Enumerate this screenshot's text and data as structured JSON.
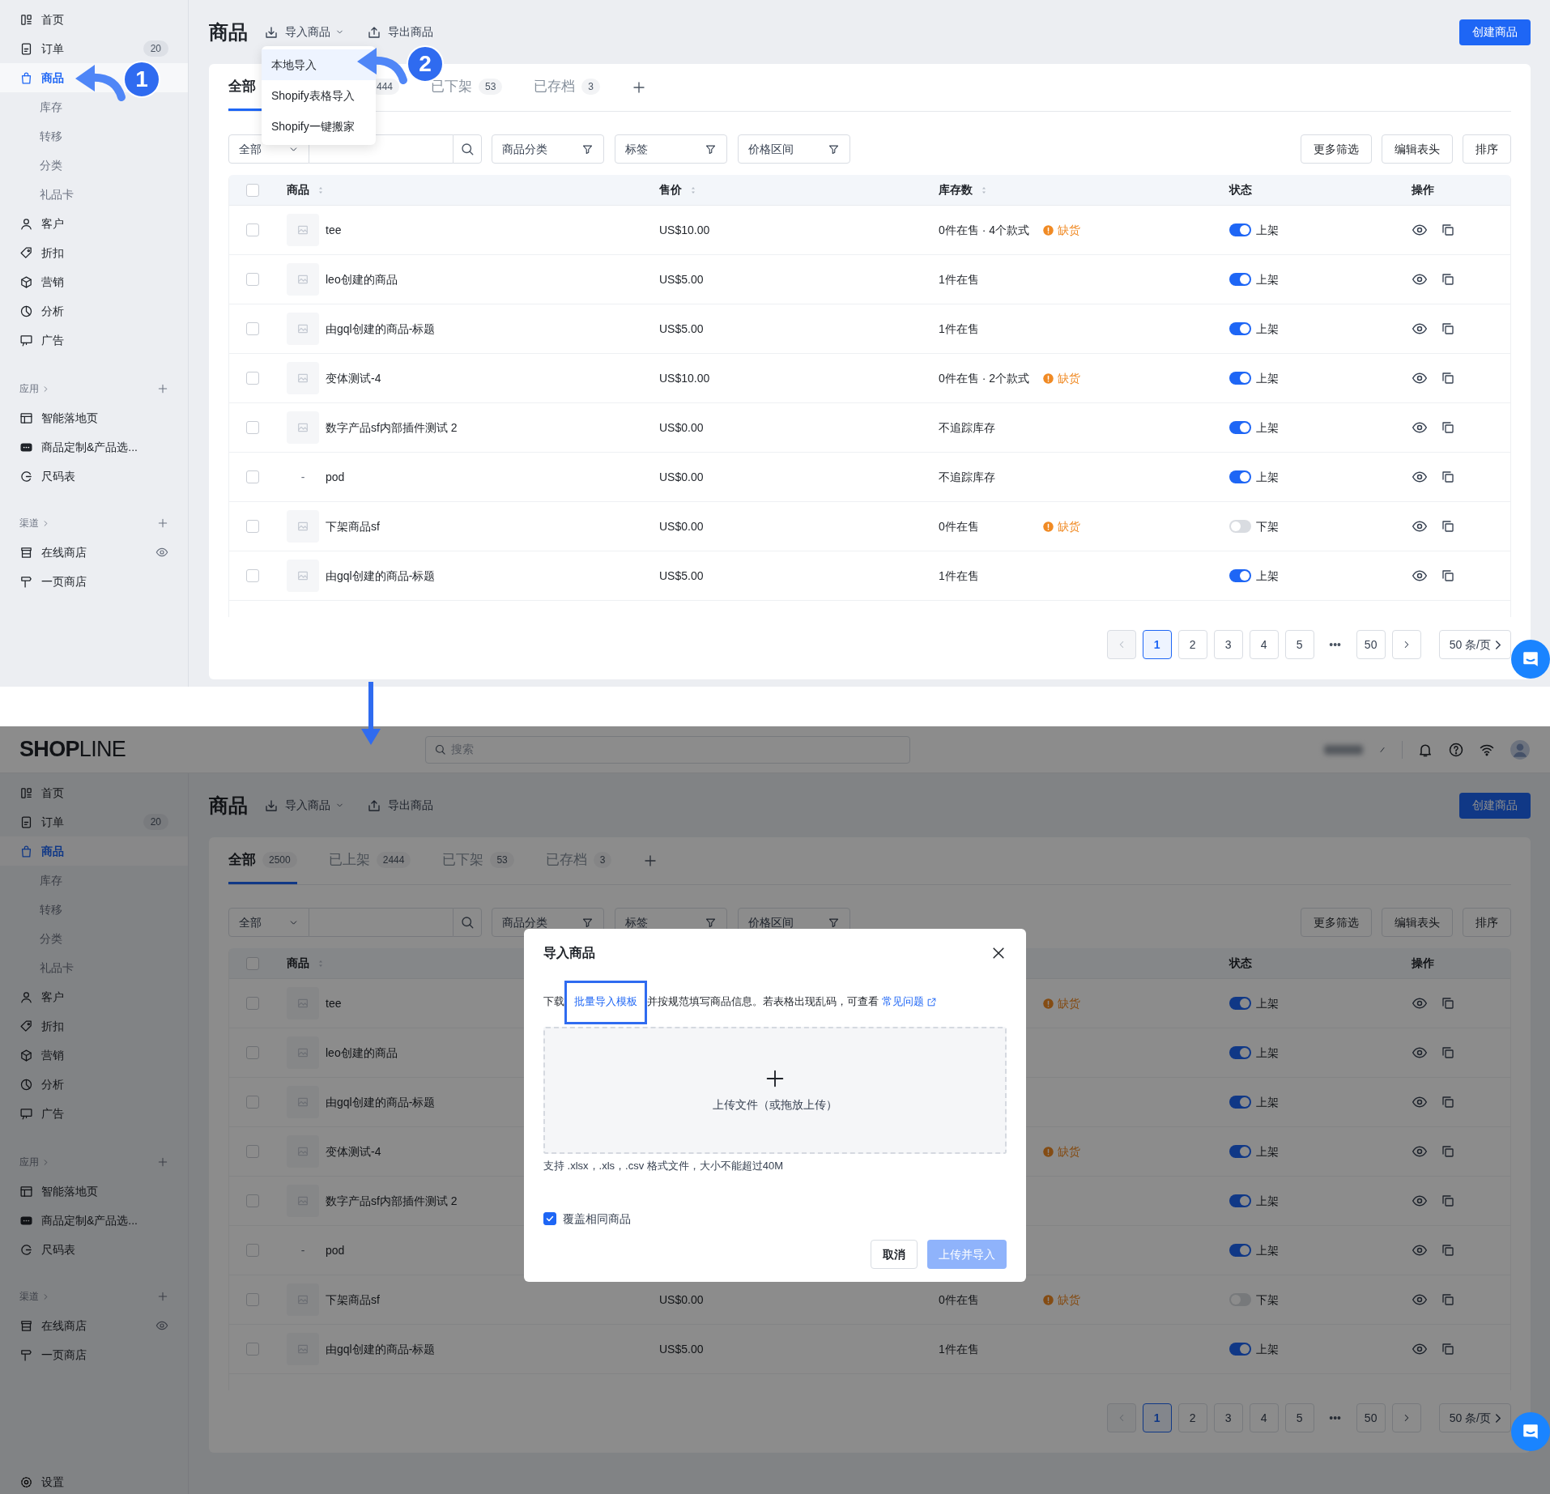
{
  "top_screen": {
    "sidebar": {
      "items": [
        {
          "label": "首页",
          "selected": false
        },
        {
          "label": "订单",
          "badge": "20",
          "selected": false
        },
        {
          "label": "商品",
          "selected": true,
          "children": [
            {
              "label": "库存",
              "selected": false
            },
            {
              "label": "转移",
              "selected": false
            },
            {
              "label": "分类",
              "selected": false
            },
            {
              "label": "礼品卡",
              "selected": false
            }
          ]
        },
        {
          "label": "客户",
          "selected": false
        },
        {
          "label": "折扣",
          "selected": false
        },
        {
          "label": "营销",
          "selected": false
        },
        {
          "label": "分析",
          "selected": false
        },
        {
          "label": "广告",
          "selected": false
        }
      ],
      "sections": [
        {
          "title": "应用",
          "items": [
            {
              "label": "智能落地页",
              "selected": false
            },
            {
              "label": "商品定制&产品选...",
              "selected": false
            },
            {
              "label": "尺码表",
              "selected": false
            }
          ]
        },
        {
          "title": "渠道",
          "items": [
            {
              "label": "在线商店",
              "selected": false,
              "kind": "previewable"
            },
            {
              "label": "一页商店",
              "selected": false
            }
          ]
        }
      ]
    },
    "page": {
      "title": "商品",
      "actions": [
        {
          "label": "导入商品",
          "kind": "dropdown"
        },
        {
          "label": "导出商品",
          "kind": "export"
        }
      ],
      "create_button": "创建商品"
    },
    "import_menu": {
      "items": [
        {
          "label": "本地导入",
          "selected": true
        },
        {
          "label": "Shopify表格导入",
          "selected": false
        },
        {
          "label": "Shopify一键搬家",
          "selected": false
        }
      ]
    },
    "steps": [
      "1",
      "2"
    ],
    "tabs": [
      {
        "label": "全部",
        "selected": true
      },
      {
        "count": "444",
        "selected": false
      },
      {
        "label": "已下架",
        "count": "53",
        "selected": false
      },
      {
        "label": "已存档",
        "count": "3",
        "selected": false
      }
    ],
    "filters": {
      "select": "全部",
      "dropdowns": [
        "商品分类",
        "标签",
        "价格区间"
      ],
      "buttons": [
        "更多筛选",
        "编辑表头",
        "排序"
      ]
    },
    "table": {
      "header_checkbox": {
        "checked": false
      },
      "columns": [
        {
          "kind": "product",
          "label": "商品",
          "sortable": true
        },
        {
          "kind": "price",
          "label": "售价",
          "sortable": true
        },
        {
          "kind": "stock",
          "label": "库存数",
          "sortable": true
        },
        {
          "kind": "status",
          "label": "状态",
          "sortable": false
        },
        {
          "kind": "actions",
          "label": "操作",
          "sortable": false
        }
      ],
      "rows": [
        {
          "checked": false,
          "name": "tee",
          "price": "US$10.00",
          "stock": "0件在售 · 4个款式",
          "shortage": "缺货",
          "on": true,
          "status": "上架"
        },
        {
          "checked": false,
          "name": "leo创建的商品",
          "price": "US$5.00",
          "stock": "1件在售",
          "on": true,
          "status": "上架"
        },
        {
          "checked": false,
          "name": "由gql创建的商品-标题",
          "price": "US$5.00",
          "stock": "1件在售",
          "on": true,
          "status": "上架"
        },
        {
          "checked": false,
          "name": "变体测试-4",
          "price": "US$10.00",
          "stock": "0件在售 · 2个款式",
          "shortage": "缺货",
          "on": true,
          "status": "上架"
        },
        {
          "checked": false,
          "name": "数字产品sf内部插件测试 2",
          "price": "US$0.00",
          "stock": "不追踪库存",
          "on": true,
          "status": "上架"
        },
        {
          "checked": false,
          "thumb_text": "-",
          "name": "pod",
          "price": "US$0.00",
          "stock": "不追踪库存",
          "on": true,
          "status": "上架"
        },
        {
          "checked": false,
          "name": "下架商品sf",
          "price": "US$0.00",
          "stock": "0件在售",
          "shortage": "缺货",
          "on": false,
          "status": "下架"
        },
        {
          "checked": false,
          "name": "由gql创建的商品-标题",
          "price": "US$5.00",
          "stock": "1件在售",
          "on": true,
          "status": "上架"
        }
      ]
    },
    "pagination": {
      "prev": {
        "disabled": true
      },
      "pages": [
        {
          "label": "1",
          "selected": true
        },
        {
          "label": "2",
          "selected": false
        },
        {
          "label": "3",
          "selected": false
        },
        {
          "label": "4",
          "selected": false
        },
        {
          "label": "5",
          "selected": false
        },
        {
          "kind": "ellipsis",
          "label": "•••"
        },
        {
          "label": "50",
          "selected": false
        }
      ],
      "next": {
        "disabled": false
      },
      "page_size": "50 条/页"
    }
  },
  "bottom_screen": {
    "top_bar": {
      "logo": "**SHOP**LINE",
      "search": {
        "placeholder": "搜索"
      }
    },
    "sidebar": {
      "items": [
        {
          "label": "首页",
          "selected": false
        },
        {
          "label": "订单",
          "badge": "20",
          "selected": false
        },
        {
          "label": "商品",
          "selected": true,
          "children": [
            {
              "label": "库存",
              "selected": false
            },
            {
              "label": "转移",
              "selected": false
            },
            {
              "label": "分类",
              "selected": false
            },
            {
              "label": "礼品卡",
              "selected": false
            }
          ]
        },
        {
          "label": "客户",
          "selected": false
        },
        {
          "label": "折扣",
          "selected": false
        },
        {
          "label": "营销",
          "selected": false
        },
        {
          "label": "分析",
          "selected": false
        },
        {
          "label": "广告",
          "selected": false
        }
      ],
      "sections": [
        {
          "title": "应用",
          "items": [
            {
              "label": "智能落地页",
              "selected": false
            },
            {
              "label": "商品定制&产品选...",
              "selected": false
            },
            {
              "label": "尺码表",
              "selected": false
            }
          ]
        },
        {
          "title": "渠道",
          "items": [
            {
              "label": "在线商店",
              "selected": false,
              "kind": "previewable"
            },
            {
              "label": "一页商店",
              "selected": false
            }
          ]
        }
      ],
      "footer": {
        "label": "设置"
      }
    },
    "page": {
      "title": "商品",
      "actions": [
        {
          "label": "导入商品",
          "kind": "dropdown"
        },
        {
          "label": "导出商品",
          "kind": "export"
        }
      ],
      "create_button": "创建商品"
    },
    "tabs": [
      {
        "label": "全部",
        "count": "2500",
        "selected": true
      },
      {
        "label": "已上架",
        "count": "2444",
        "selected": false
      },
      {
        "label": "已下架",
        "count": "53",
        "selected": false
      },
      {
        "label": "已存档",
        "count": "3",
        "selected": false
      }
    ],
    "filters": {
      "select": "全部",
      "dropdowns": [
        "商品分类",
        "标签",
        "价格区间"
      ],
      "buttons": [
        "更多筛选",
        "编辑表头",
        "排序"
      ]
    },
    "table": {
      "header_checkbox": {
        "checked": false
      },
      "columns": [
        {
          "kind": "product",
          "label": "商品",
          "sortable": true
        },
        {
          "kind": "status",
          "label": "状态",
          "sortable": false
        },
        {
          "kind": "actions",
          "label": "操作",
          "sortable": false
        }
      ],
      "rows": [
        {
          "checked": false,
          "name": "tee",
          "shortage": "缺货",
          "on": true,
          "status": "上架"
        },
        {
          "checked": false,
          "name": "leo创建的商品",
          "on": true,
          "status": "上架"
        },
        {
          "checked": false,
          "name": "由gql创建的商品-标题",
          "on": true,
          "status": "上架"
        },
        {
          "checked": false,
          "name": "变体测试-4",
          "shortage": "缺货",
          "on": true,
          "status": "上架"
        },
        {
          "checked": false,
          "name": "数字产品sf内部插件测试 2",
          "on": true,
          "status": "上架"
        },
        {
          "checked": false,
          "thumb_text": "-",
          "name": "pod",
          "on": true,
          "status": "上架"
        },
        {
          "checked": false,
          "name": "下架商品sf",
          "price": "US$0.00",
          "stock": "0件在售",
          "shortage": "缺货",
          "on": false,
          "status": "下架"
        },
        {
          "checked": false,
          "name": "由gql创建的商品-标题",
          "price": "US$5.00",
          "stock": "1件在售",
          "on": true,
          "status": "上架"
        }
      ]
    },
    "pagination": {
      "prev": {
        "disabled": true
      },
      "pages": [
        {
          "label": "1",
          "selected": true
        },
        {
          "label": "2",
          "selected": false
        },
        {
          "label": "3",
          "selected": false
        },
        {
          "label": "4",
          "selected": false
        },
        {
          "label": "5",
          "selected": false
        },
        {
          "kind": "ellipsis",
          "label": "•••"
        },
        {
          "label": "50",
          "selected": false
        }
      ],
      "next": {
        "disabled": false
      },
      "page_size": "50 条/页"
    },
    "import_dialog": {
      "title": "导入商品",
      "text_before": "下载",
      "template_link": "批量导入模板",
      "text_middle": "并按规范填写商品信息。若表格出现乱码，可查看",
      "faq_link": "常见问题",
      "upload_label": "上传文件（或拖放上传）",
      "hint": "支持 .xlsx，.xls，.csv 格式文件，大小不能超过40M",
      "overwrite": {
        "label": "覆盖相同商品",
        "checked": true
      },
      "buttons": [
        {
          "label": "取消",
          "kind": "secondary",
          "disabled": false
        },
        {
          "label": "上传并导入",
          "kind": "primary",
          "disabled": true
        }
      ]
    }
  }
}
